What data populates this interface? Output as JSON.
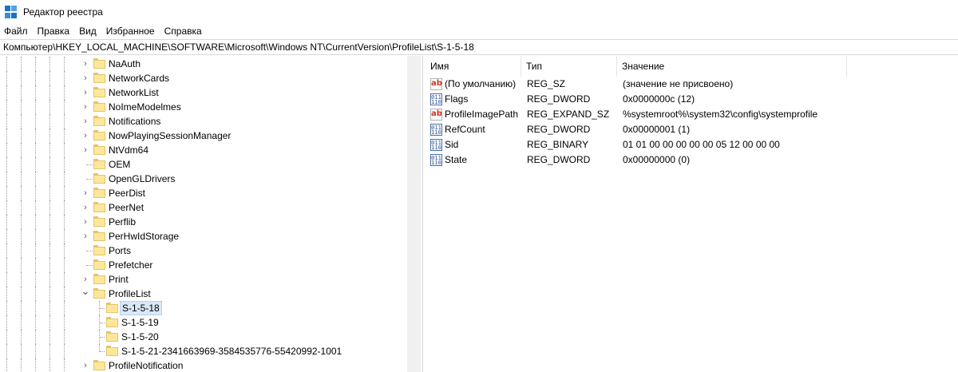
{
  "window": {
    "title": "Редактор реестра"
  },
  "menu": [
    "Файл",
    "Правка",
    "Вид",
    "Избранное",
    "Справка"
  ],
  "address": "Компьютер\\HKEY_LOCAL_MACHINE\\SOFTWARE\\Microsoft\\Windows NT\\CurrentVersion\\ProfileList\\S-1-5-18",
  "tree": [
    {
      "label": "NaAuth",
      "expander": "collapsed"
    },
    {
      "label": "NetworkCards",
      "expander": "collapsed"
    },
    {
      "label": "NetworkList",
      "expander": "collapsed"
    },
    {
      "label": "NoImeModelmes",
      "expander": "collapsed"
    },
    {
      "label": "Notifications",
      "expander": "collapsed"
    },
    {
      "label": "NowPlayingSessionManager",
      "expander": "collapsed"
    },
    {
      "label": "NtVdm64",
      "expander": "collapsed"
    },
    {
      "label": "OEM",
      "expander": "none"
    },
    {
      "label": "OpenGLDrivers",
      "expander": "none"
    },
    {
      "label": "PeerDist",
      "expander": "collapsed"
    },
    {
      "label": "PeerNet",
      "expander": "collapsed"
    },
    {
      "label": "Perflib",
      "expander": "collapsed"
    },
    {
      "label": "PerHwIdStorage",
      "expander": "collapsed"
    },
    {
      "label": "Ports",
      "expander": "none"
    },
    {
      "label": "Prefetcher",
      "expander": "none"
    },
    {
      "label": "Print",
      "expander": "collapsed"
    },
    {
      "label": "ProfileList",
      "expander": "expanded"
    },
    {
      "label": "S-1-5-18",
      "expander": "none",
      "child": true,
      "selected": true
    },
    {
      "label": "S-1-5-19",
      "expander": "none",
      "child": true
    },
    {
      "label": "S-1-5-20",
      "expander": "none",
      "child": true
    },
    {
      "label": "S-1-5-21-2341663969-3584535776-55420992-1001",
      "expander": "none",
      "child": true,
      "last": true
    },
    {
      "label": "ProfileNotification",
      "expander": "collapsed"
    }
  ],
  "values": {
    "headers": {
      "name": "Имя",
      "type": "Тип",
      "data": "Значение"
    },
    "rows": [
      {
        "icon": "string-value-icon",
        "name": "(По умолчанию)",
        "type": "REG_SZ",
        "data": "(значение не присвоено)"
      },
      {
        "icon": "binary-value-icon",
        "name": "Flags",
        "type": "REG_DWORD",
        "data": "0x0000000c (12)"
      },
      {
        "icon": "string-value-icon",
        "name": "ProfileImagePath",
        "type": "REG_EXPAND_SZ",
        "data": "%systemroot%\\system32\\config\\systemprofile"
      },
      {
        "icon": "binary-value-icon",
        "name": "RefCount",
        "type": "REG_DWORD",
        "data": "0x00000001 (1)"
      },
      {
        "icon": "binary-value-icon",
        "name": "Sid",
        "type": "REG_BINARY",
        "data": "01 01 00 00 00 00 00 05 12 00 00 00"
      },
      {
        "icon": "binary-value-icon",
        "name": "State",
        "type": "REG_DWORD",
        "data": "0x00000000 (0)"
      }
    ]
  }
}
